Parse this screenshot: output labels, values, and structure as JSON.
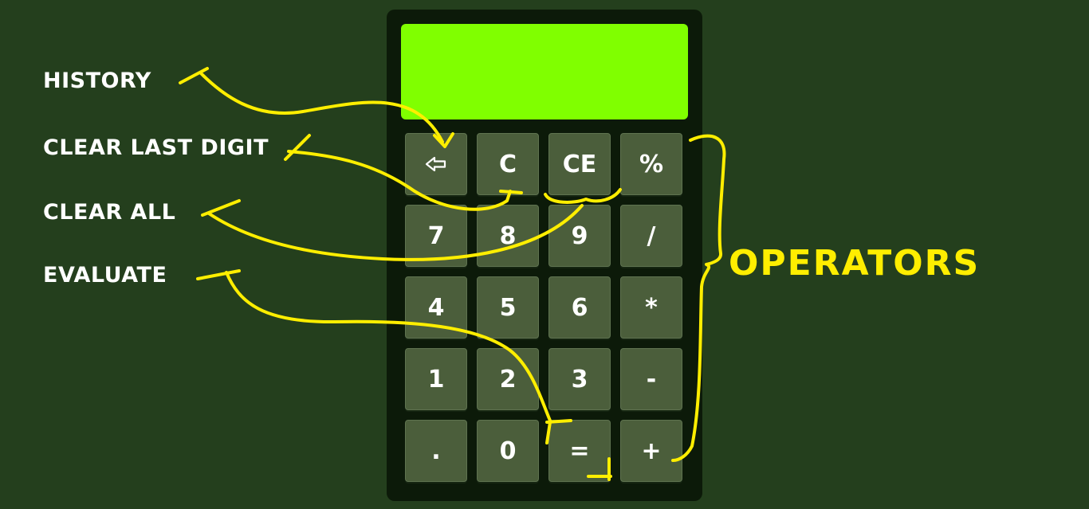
{
  "labels": {
    "history": "HISTORY",
    "clear_last_digit": "CLEAR LAST DIGIT",
    "clear_all": "CLEAR ALL",
    "evaluate": "EVALUATE"
  },
  "display": {
    "value": ""
  },
  "keys": {
    "history": "",
    "clear": "C",
    "clear_entry": "CE",
    "percent": "%",
    "seven": "7",
    "eight": "8",
    "nine": "9",
    "divide": "/",
    "four": "4",
    "five": "5",
    "six": "6",
    "multiply": "*",
    "one": "1",
    "two": "2",
    "three": "3",
    "minus": "-",
    "dot": ".",
    "zero": "0",
    "equals": "=",
    "plus": "+"
  },
  "annotation": {
    "operators": "OPERATORS"
  },
  "colors": {
    "background": "#243f1d",
    "calculator_body": "#0c1a09",
    "display": "#80ff00",
    "key": "#4b5e3b",
    "annotation": "#ffee00"
  }
}
